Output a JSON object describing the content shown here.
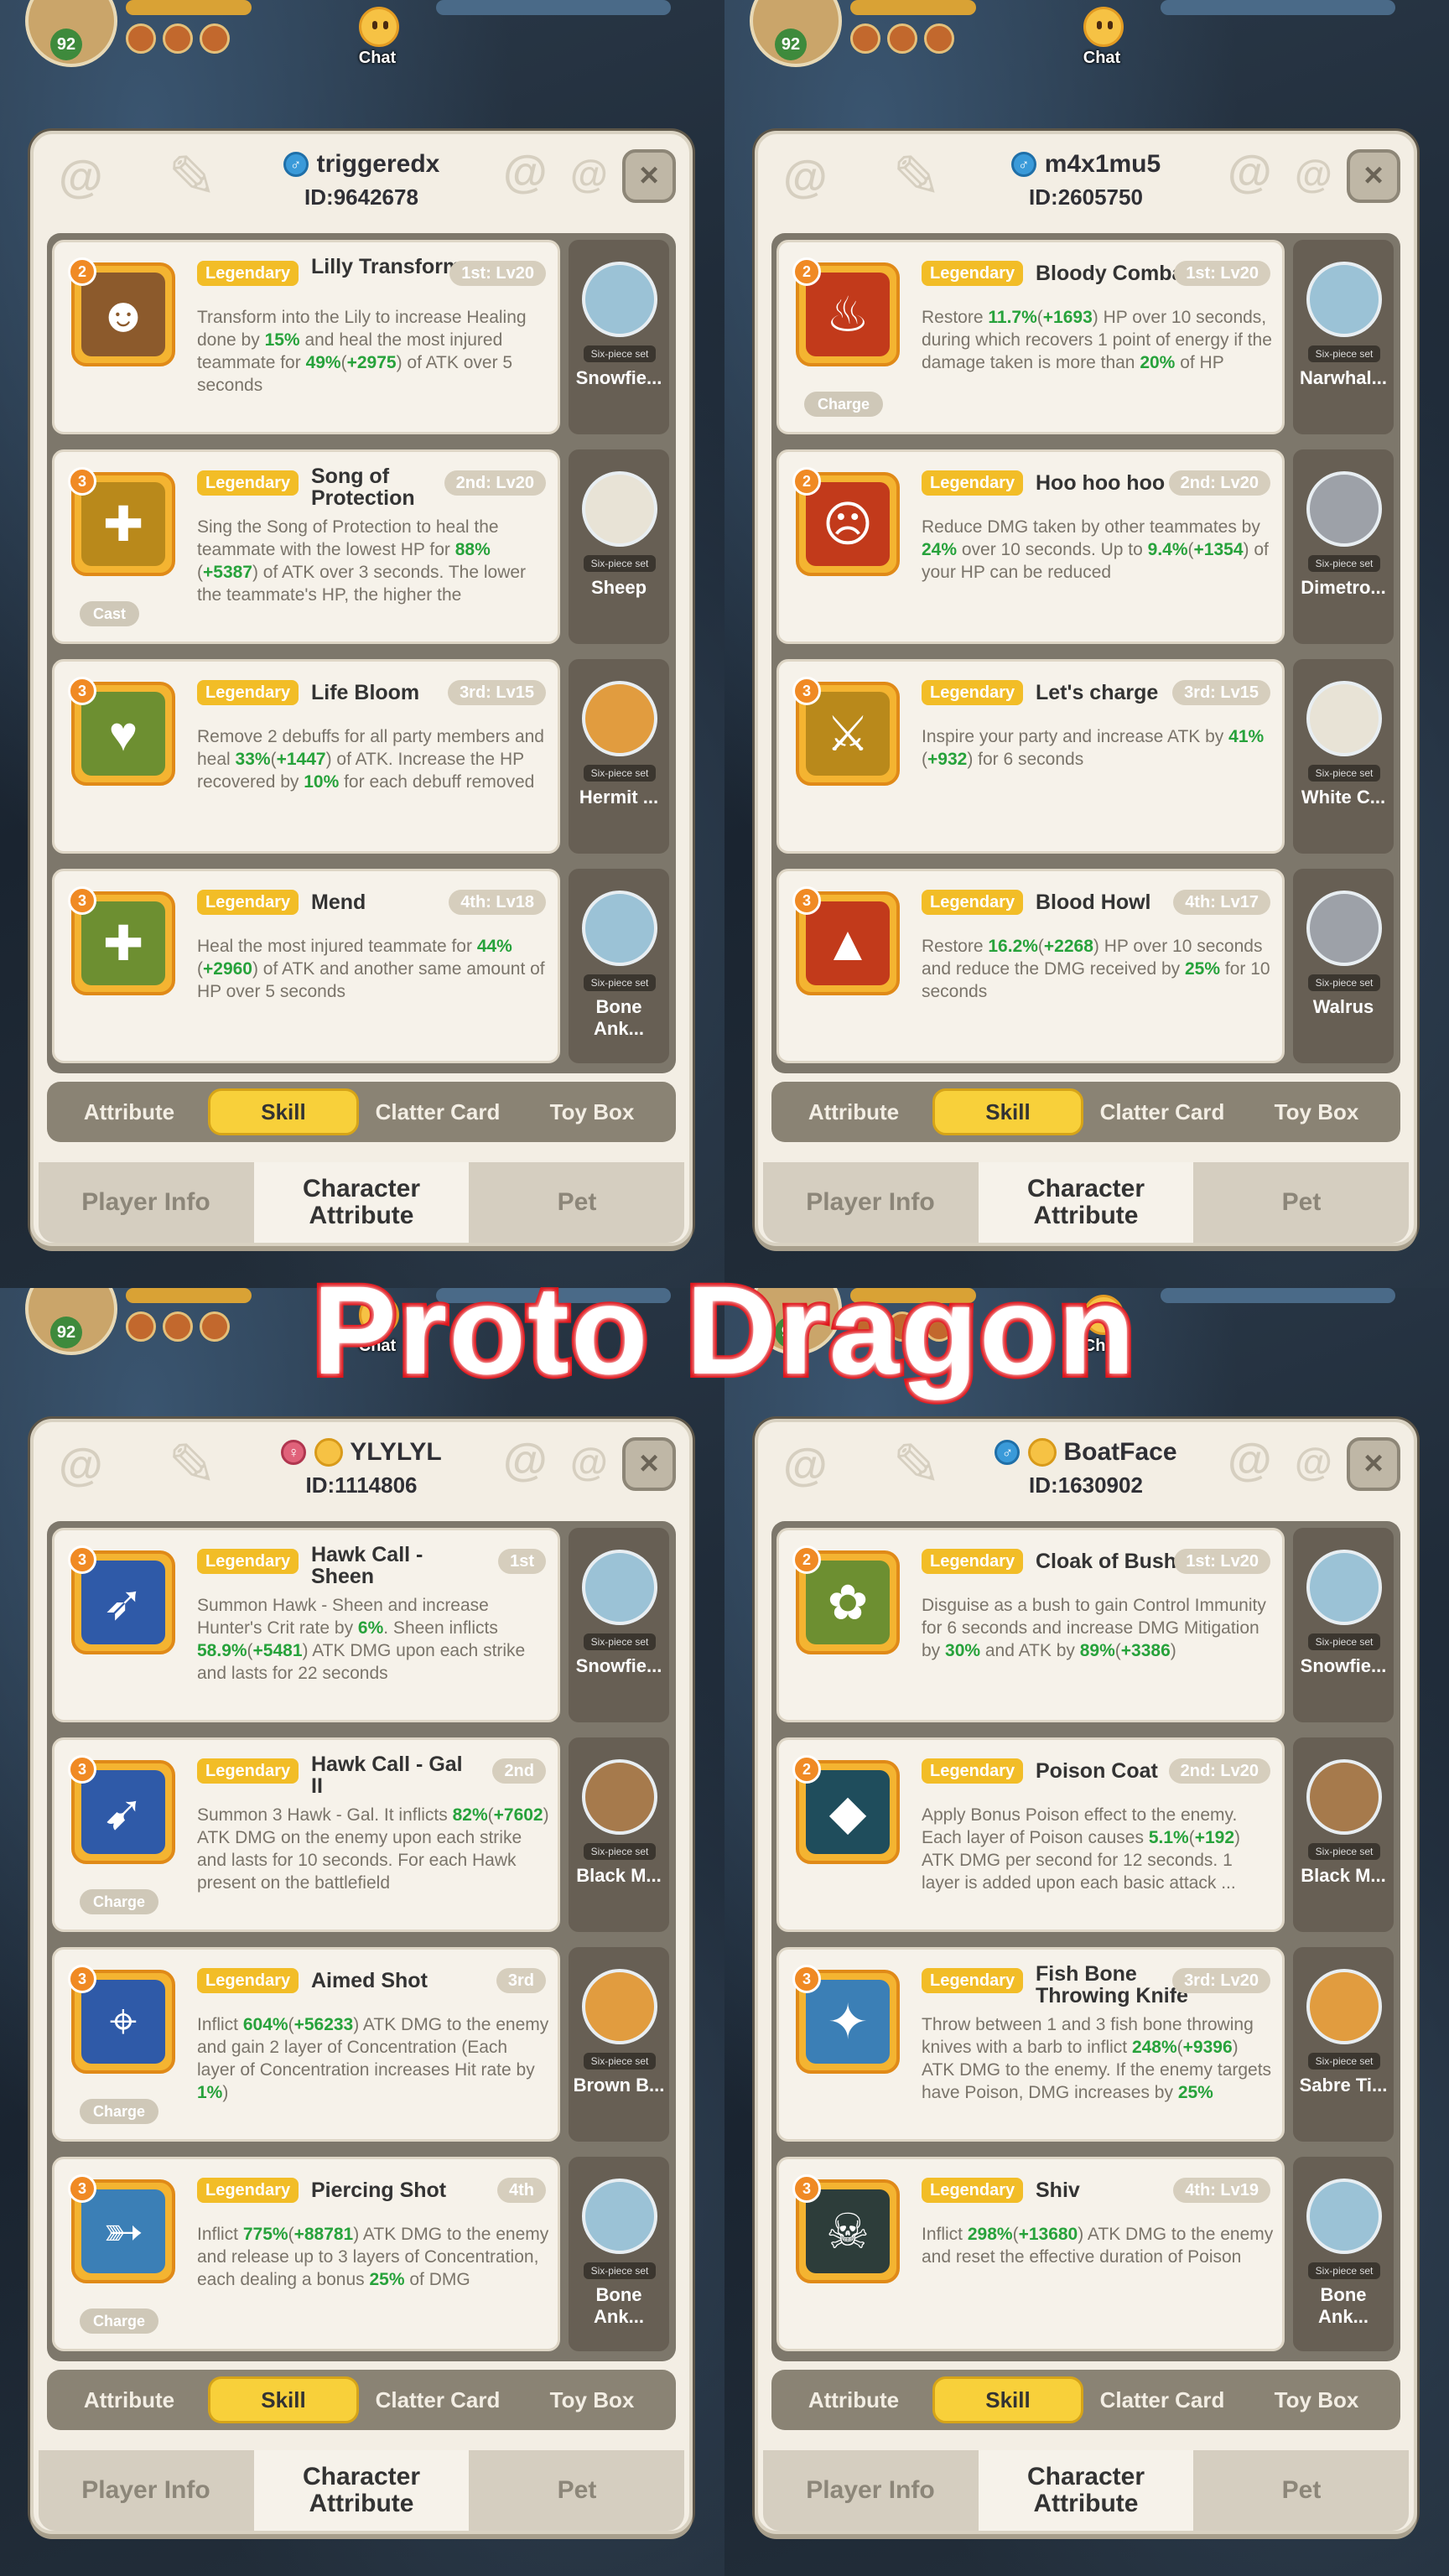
{
  "banner": "Proto Dragon",
  "chat_label": "Chat",
  "hud_level": "92",
  "labels": {
    "legendary": "Legendary",
    "six_piece": "Six-piece set",
    "close": "×"
  },
  "subtabs": [
    "Attribute",
    "Skill",
    "Clatter Card",
    "Toy Box"
  ],
  "maintabs": [
    "Player Info",
    "Character Attribute",
    "Pet"
  ],
  "panels": [
    {
      "name": "triggeredx",
      "id": "ID:9642678",
      "gender": "male",
      "skills": [
        {
          "stars": "2",
          "name": "Lilly Transform",
          "rank": "1st: Lv20",
          "tag": "",
          "desc": "Transform into the Lily to increase Healing done by 15% and heal the most injured teammate for 49%(+2975) of ATK over 5 seconds",
          "pet": "Snowfie..."
        },
        {
          "stars": "3",
          "name": "Song of Protection",
          "rank": "2nd: Lv20",
          "tag": "Cast",
          "desc": "Sing the Song of Protection to heal the teammate with the lowest HP for 88%(+5387) of ATK over 3 seconds. The lower the teammate's HP, the higher the",
          "pet": "Sheep"
        },
        {
          "stars": "3",
          "name": "Life Bloom",
          "rank": "3rd: Lv15",
          "tag": "",
          "desc": "Remove 2 debuffs for all party members and heal 33%(+1447) of ATK. Increase the HP recovered by 10% for each debuff removed",
          "pet": "Hermit ..."
        },
        {
          "stars": "3",
          "name": "Mend",
          "rank": "4th: Lv18",
          "tag": "",
          "desc": "Heal the most injured teammate for 44%(+2960) of ATK and another same amount of HP over 5 seconds",
          "pet": "Bone Ank..."
        }
      ]
    },
    {
      "name": "m4x1mu5",
      "id": "ID:2605750",
      "gender": "male",
      "skills": [
        {
          "stars": "2",
          "name": "Bloody Combat",
          "rank": "1st: Lv20",
          "tag": "Charge",
          "desc": "Restore 11.7%(+1693) HP over 10 seconds, during which recovers 1 point of energy if the damage taken is more than 20% of HP",
          "pet": "Narwhal..."
        },
        {
          "stars": "2",
          "name": "Hoo hoo hoo",
          "rank": "2nd: Lv20",
          "tag": "",
          "desc": "Reduce DMG taken by other teammates by 24% over 10 seconds. Up to 9.4%(+1354) of your HP can be reduced",
          "pet": "Dimetro..."
        },
        {
          "stars": "3",
          "name": "Let's charge",
          "rank": "3rd: Lv15",
          "tag": "",
          "desc": "Inspire your party and increase ATK by 41%(+932) for 6 seconds",
          "pet": "White C..."
        },
        {
          "stars": "3",
          "name": "Blood Howl",
          "rank": "4th: Lv17",
          "tag": "",
          "desc": "Restore 16.2%(+2268) HP over 10 seconds and reduce the DMG received by 25% for 10 seconds",
          "pet": "Walrus"
        }
      ]
    },
    {
      "name": "YLYLYL",
      "id": "ID:1114806",
      "gender": "female",
      "skills": [
        {
          "stars": "3",
          "name": "Hawk Call - Sheen",
          "rank": "1st",
          "tag": "",
          "desc": "Summon Hawk - Sheen and increase Hunter's Crit rate by 6%. Sheen inflicts 58.9%(+5481) ATK DMG upon each strike and lasts for 22 seconds",
          "pet": "Snowfie..."
        },
        {
          "stars": "3",
          "name": "Hawk Call - Gal II",
          "rank": "2nd",
          "tag": "Charge",
          "desc": "Summon 3 Hawk - Gal. It inflicts 82%(+7602) ATK DMG on the enemy upon each strike and lasts for 10 seconds. For each Hawk present on the battlefield",
          "pet": "Black M..."
        },
        {
          "stars": "3",
          "name": "Aimed Shot",
          "rank": "3rd",
          "tag": "Charge",
          "desc": "Inflict 604%(+56233) ATK DMG to the enemy and gain 2 layer of Concentration (Each layer of Concentration increases Hit rate by 1%)",
          "pet": "Brown B..."
        },
        {
          "stars": "3",
          "name": "Piercing Shot",
          "rank": "4th",
          "tag": "Charge",
          "desc": "Inflict 775%(+88781) ATK DMG to the enemy and release up to 3 layers of Concentration, each dealing a bonus 25% of DMG",
          "pet": "Bone Ank..."
        }
      ]
    },
    {
      "name": "BoatFace",
      "id": "ID:1630902",
      "gender": "male",
      "skills": [
        {
          "stars": "2",
          "name": "Cloak of Bush",
          "rank": "1st: Lv20",
          "tag": "",
          "desc": "Disguise as a bush to gain Control Immunity for 6 seconds and increase DMG Mitigation by 30% and ATK by 89%(+3386)",
          "pet": "Snowfie..."
        },
        {
          "stars": "2",
          "name": "Poison Coat",
          "rank": "2nd: Lv20",
          "tag": "",
          "desc": "Apply Bonus Poison effect to the enemy. Each layer of Poison causes 5.1%(+192) ATK DMG per second for 12 seconds. 1 layer is added upon each basic attack ...",
          "pet": "Black M..."
        },
        {
          "stars": "3",
          "name": "Fish Bone Throwing Knife",
          "rank": "3rd: Lv20",
          "tag": "",
          "desc": "Throw between 1 and 3 fish bone throwing knives with a barb to inflict 248%(+9396) ATK DMG to the enemy. If the enemy targets have Poison, DMG increases by 25%",
          "pet": "Sabre Ti..."
        },
        {
          "stars": "3",
          "name": "Shiv",
          "rank": "4th: Lv19",
          "tag": "",
          "desc": "Inflict 298%(+13680) ATK DMG to the enemy and reset the effective duration of Poison",
          "pet": "Bone Ank..."
        }
      ]
    }
  ],
  "icons": {
    "panels": [
      [
        "owl-icon",
        "shield-heal-icon",
        "heart-bloom-icon",
        "cross-heal-icon"
      ],
      [
        "blood-drops-icon",
        "angry-face-icon",
        "charge-crowd-icon",
        "blood-howl-icon"
      ],
      [
        "hawk-sheen-icon",
        "hawk-gal-icon",
        "crosshair-icon",
        "piercing-arrow-icon"
      ],
      [
        "bush-icon",
        "poison-drop-icon",
        "fish-bone-knife-icon",
        "skull-dagger-icon"
      ]
    ]
  },
  "colors": {
    "legendary": "#f2bd27",
    "value_green": "#27a23b",
    "active_tab": "#f8d03a",
    "banner_stroke": "#e0141a"
  }
}
